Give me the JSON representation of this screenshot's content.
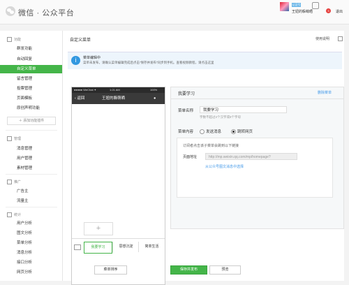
{
  "header": {
    "brand": "微信 · 公众平台",
    "user_tag": "认证号",
    "user_name": "王妞的躲萌晒",
    "badge": "3",
    "logout": "退出"
  },
  "sidebar": {
    "sections": [
      {
        "title": "功能",
        "items": [
          "群发功能",
          "自动回复",
          "自定义菜单",
          "留言管理",
          "投票管理",
          "页面模板",
          "原创声明功能"
        ]
      },
      {
        "title": "管理",
        "items": [
          "消息管理",
          "用户管理",
          "素材管理"
        ]
      },
      {
        "title": "推广",
        "items": [
          "广告主",
          "流量主"
        ]
      },
      {
        "title": "统计",
        "items": [
          "用户分析",
          "图文分析",
          "菜单分析",
          "消息分析",
          "接口分析",
          "网页分析"
        ]
      }
    ],
    "add_plugin": "＋ 添加功能插件",
    "active_item": "自定义菜单"
  },
  "content": {
    "breadcrumb": "自定义菜单",
    "help": "使用说明",
    "notice_title": "菜单编辑中",
    "notice_text": "菜单未发布，请确认菜单编辑完成后点击“保存并发布”同步到手机。查看视频教程，请点击这里"
  },
  "phone": {
    "status_left": "●●●●● WeChat ✦",
    "status_time": "1:21 AM",
    "status_right": "100%",
    "back": "返回",
    "title": "王妞的躲萌晒",
    "add_symbol": "+",
    "menu_tabs": [
      "我要学习",
      "思想沉淀",
      "简单生活"
    ]
  },
  "editor": {
    "title": "我要学习",
    "delete_label": "删除菜单",
    "name_label": "菜单名称",
    "name_value": "我要学习",
    "name_hint": "字数不超过4个汉字或8个字母",
    "content_label": "菜单内容",
    "option_send": "发送消息",
    "option_jump": "跳转网页",
    "jump_hint": "订阅者点击该子菜单会跳到以下链接",
    "url_label": "页面地址",
    "url_placeholder": "http://mp.weixin.qq.com/mp/homepage?",
    "select_link": "从公众号图文消息中选择"
  },
  "footer": {
    "sort": "菜单排序",
    "save": "保存并发布",
    "preview": "预览"
  }
}
